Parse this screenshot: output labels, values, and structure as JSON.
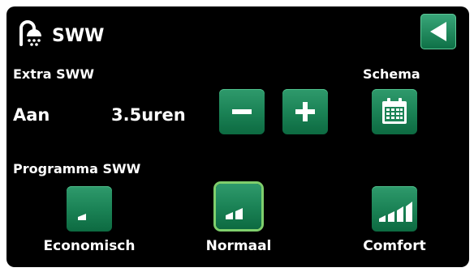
{
  "header": {
    "title": "SWW",
    "icon": "shower-icon",
    "back_icon": "back-arrow-icon"
  },
  "extra": {
    "label": "Extra SWW",
    "state": "Aan",
    "duration": "3.5uren",
    "minus_icon": "minus-icon",
    "plus_icon": "plus-icon"
  },
  "schedule": {
    "label": "Schema",
    "icon": "calendar-icon"
  },
  "program": {
    "label": "Programma SWW",
    "options": [
      {
        "label": "Economisch",
        "icon": "level-low-icon",
        "selected": false
      },
      {
        "label": "Normaal",
        "icon": "level-medium-icon",
        "selected": true
      },
      {
        "label": "Comfort",
        "icon": "level-high-icon",
        "selected": false
      }
    ]
  },
  "colors": {
    "background": "#000000",
    "button": "#1b8356",
    "selected_outline": "#7fcf6c",
    "text": "#ffffff"
  }
}
